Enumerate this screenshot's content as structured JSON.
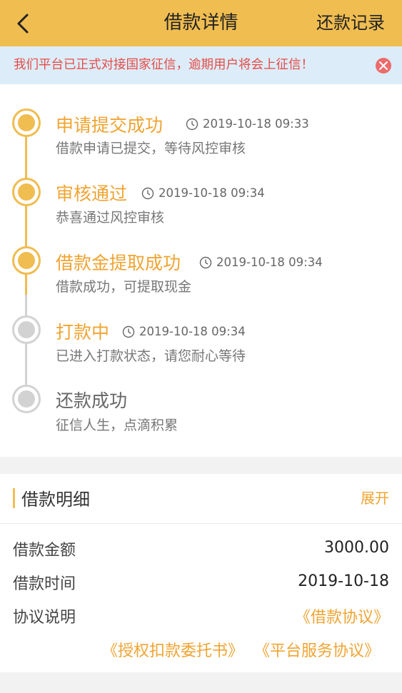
{
  "header": {
    "title": "借款详情",
    "right_label": "还款记录"
  },
  "notice": {
    "text": "我们平台已正式对接国家征信，逾期用户将会上征信！"
  },
  "timeline": {
    "steps": [
      {
        "title": "申请提交成功",
        "time": "2019-10-18 09:33",
        "desc": "借款申请已提交，等待风控审核",
        "status": "done"
      },
      {
        "title": "审核通过",
        "time": "2019-10-18 09:34",
        "desc": "恭喜通过风控审核",
        "status": "done"
      },
      {
        "title": "借款金提取成功",
        "time": "2019-10-18 09:34",
        "desc": "借款成功，可提取现金",
        "status": "done"
      },
      {
        "title": "打款中",
        "time": "2019-10-18 09:34",
        "desc": "已进入打款状态，请您耐心等待",
        "status": "current"
      },
      {
        "title": "还款成功",
        "time": "",
        "desc": "征信人生，点滴积累",
        "status": "pending"
      }
    ]
  },
  "detail": {
    "title": "借款明细",
    "expand_label": "展开",
    "amount_label": "借款金额",
    "amount_value": "3000.00",
    "date_label": "借款时间",
    "date_value": "2019-10-18",
    "agreement_label": "协议说明",
    "links": {
      "loan_agreement": "《借款协议》",
      "authorization": "《授权扣款委托书》",
      "platform_service": "《平台服务协议》"
    }
  },
  "colors": {
    "accent": "#f0bd51",
    "accent_text": "#f0a432",
    "notice_bg": "#dcedf9",
    "notice_text": "#e64b46",
    "inactive": "#d2d2d2"
  }
}
